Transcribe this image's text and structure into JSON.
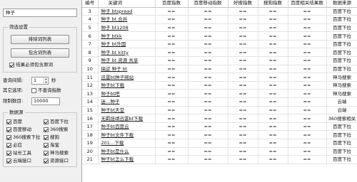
{
  "search": {
    "value": "种子"
  },
  "filter_group": {
    "title": "筛选设置",
    "exclude_btn": "排除词列表",
    "include_btn": "包含词列表",
    "must_include_label": "结果必须包含原词",
    "must_include_checked": true
  },
  "settings": {
    "interval_label": "查询间隔:",
    "interval_value": "1",
    "interval_unit": "秒",
    "other_label": "其它选项:",
    "no_index_label": "不查询指数",
    "no_index_checked": false,
    "limit_label": "限制数目:",
    "limit_value": "10000"
  },
  "sources": {
    "title": "数据源",
    "items": [
      {
        "label": "百度",
        "checked": true
      },
      {
        "label": "百度下拉",
        "checked": true
      },
      {
        "label": "百度移动",
        "checked": true
      },
      {
        "label": "360搜索",
        "checked": true
      },
      {
        "label": "360搜索下拉",
        "checked": true
      },
      {
        "label": "搜狗",
        "checked": true
      },
      {
        "label": "必应",
        "checked": true
      },
      {
        "label": "淘宝",
        "checked": true
      },
      {
        "label": "站长工具",
        "checked": true
      },
      {
        "label": "神马搜索",
        "checked": true
      },
      {
        "label": "云端接口",
        "checked": true
      },
      {
        "label": "资源接口",
        "checked": true
      }
    ]
  },
  "table": {
    "headers": [
      "编号",
      "关键词",
      "百度指数",
      "百度移动指数",
      "好搜指数",
      "搜狗指数",
      "百度相关结果数",
      "数据来源"
    ],
    "rows": [
      [
        "3",
        "种子 btspread",
        "==",
        "==",
        "==",
        "==",
        "==",
        "百度下拉"
      ],
      [
        "4",
        "种子 bt 合并",
        "==",
        "==",
        "==",
        "==",
        "==",
        "百度下拉"
      ],
      [
        "5",
        "种子 bt1208",
        "==",
        "==",
        "==",
        "==",
        "==",
        "百度下拉"
      ],
      [
        "6",
        "种子 btkk",
        "==",
        "==",
        "==",
        "==",
        "==",
        "百度下拉"
      ],
      [
        "7",
        "种子 bt外国",
        "==",
        "==",
        "==",
        "==",
        "==",
        "百度下拉"
      ],
      [
        "8",
        "种子 bt kitty",
        "==",
        "==",
        "==",
        "==",
        "==",
        "百度下拉"
      ],
      [
        "9",
        "种子 bt 资源 共享",
        "==",
        "==",
        "==",
        "==",
        "==",
        "百度下拉"
      ],
      [
        "10",
        "搞逆 种子 bt",
        "==",
        "==",
        "==",
        "==",
        "==",
        "百度下拉"
      ],
      [
        "11",
        "迅雷bt种子网站",
        "==",
        "==",
        "==",
        "==",
        "==",
        "神马搜索"
      ],
      [
        "12",
        "种子bt下载",
        "==",
        "==",
        "==",
        "==",
        "==",
        "神马搜索"
      ],
      [
        "13",
        "种子bt吧",
        "==",
        "==",
        "==",
        "==",
        "==",
        "神马搜索"
      ],
      [
        "14",
        "迷…种子",
        "==",
        "==",
        "==",
        "==",
        "==",
        "云端"
      ],
      [
        "15",
        "种子bt天堂",
        "==",
        "==",
        "==",
        "==",
        "==",
        "云端"
      ],
      [
        "16",
        "无羁挂靖迅雷bt下载",
        "==",
        "==",
        "==",
        "==",
        "==",
        "360搜索相关"
      ],
      [
        "17",
        "种子bt百度云",
        "==",
        "==",
        "==",
        "==",
        "==",
        "百度下拉"
      ],
      [
        "18",
        "种子bt文件下载",
        "==",
        "==",
        "==",
        "==",
        "==",
        "百度下拉"
      ],
      [
        "19",
        "201…下载",
        "==",
        "==",
        "==",
        "==",
        "==",
        "百度下拉"
      ],
      [
        "20",
        "种子bt是什么",
        "==",
        "==",
        "==",
        "==",
        "==",
        "百度下拉"
      ],
      [
        "21",
        "种子bt怎么下载",
        "==",
        "==",
        "==",
        "==",
        "==",
        "百度下拉"
      ]
    ]
  }
}
